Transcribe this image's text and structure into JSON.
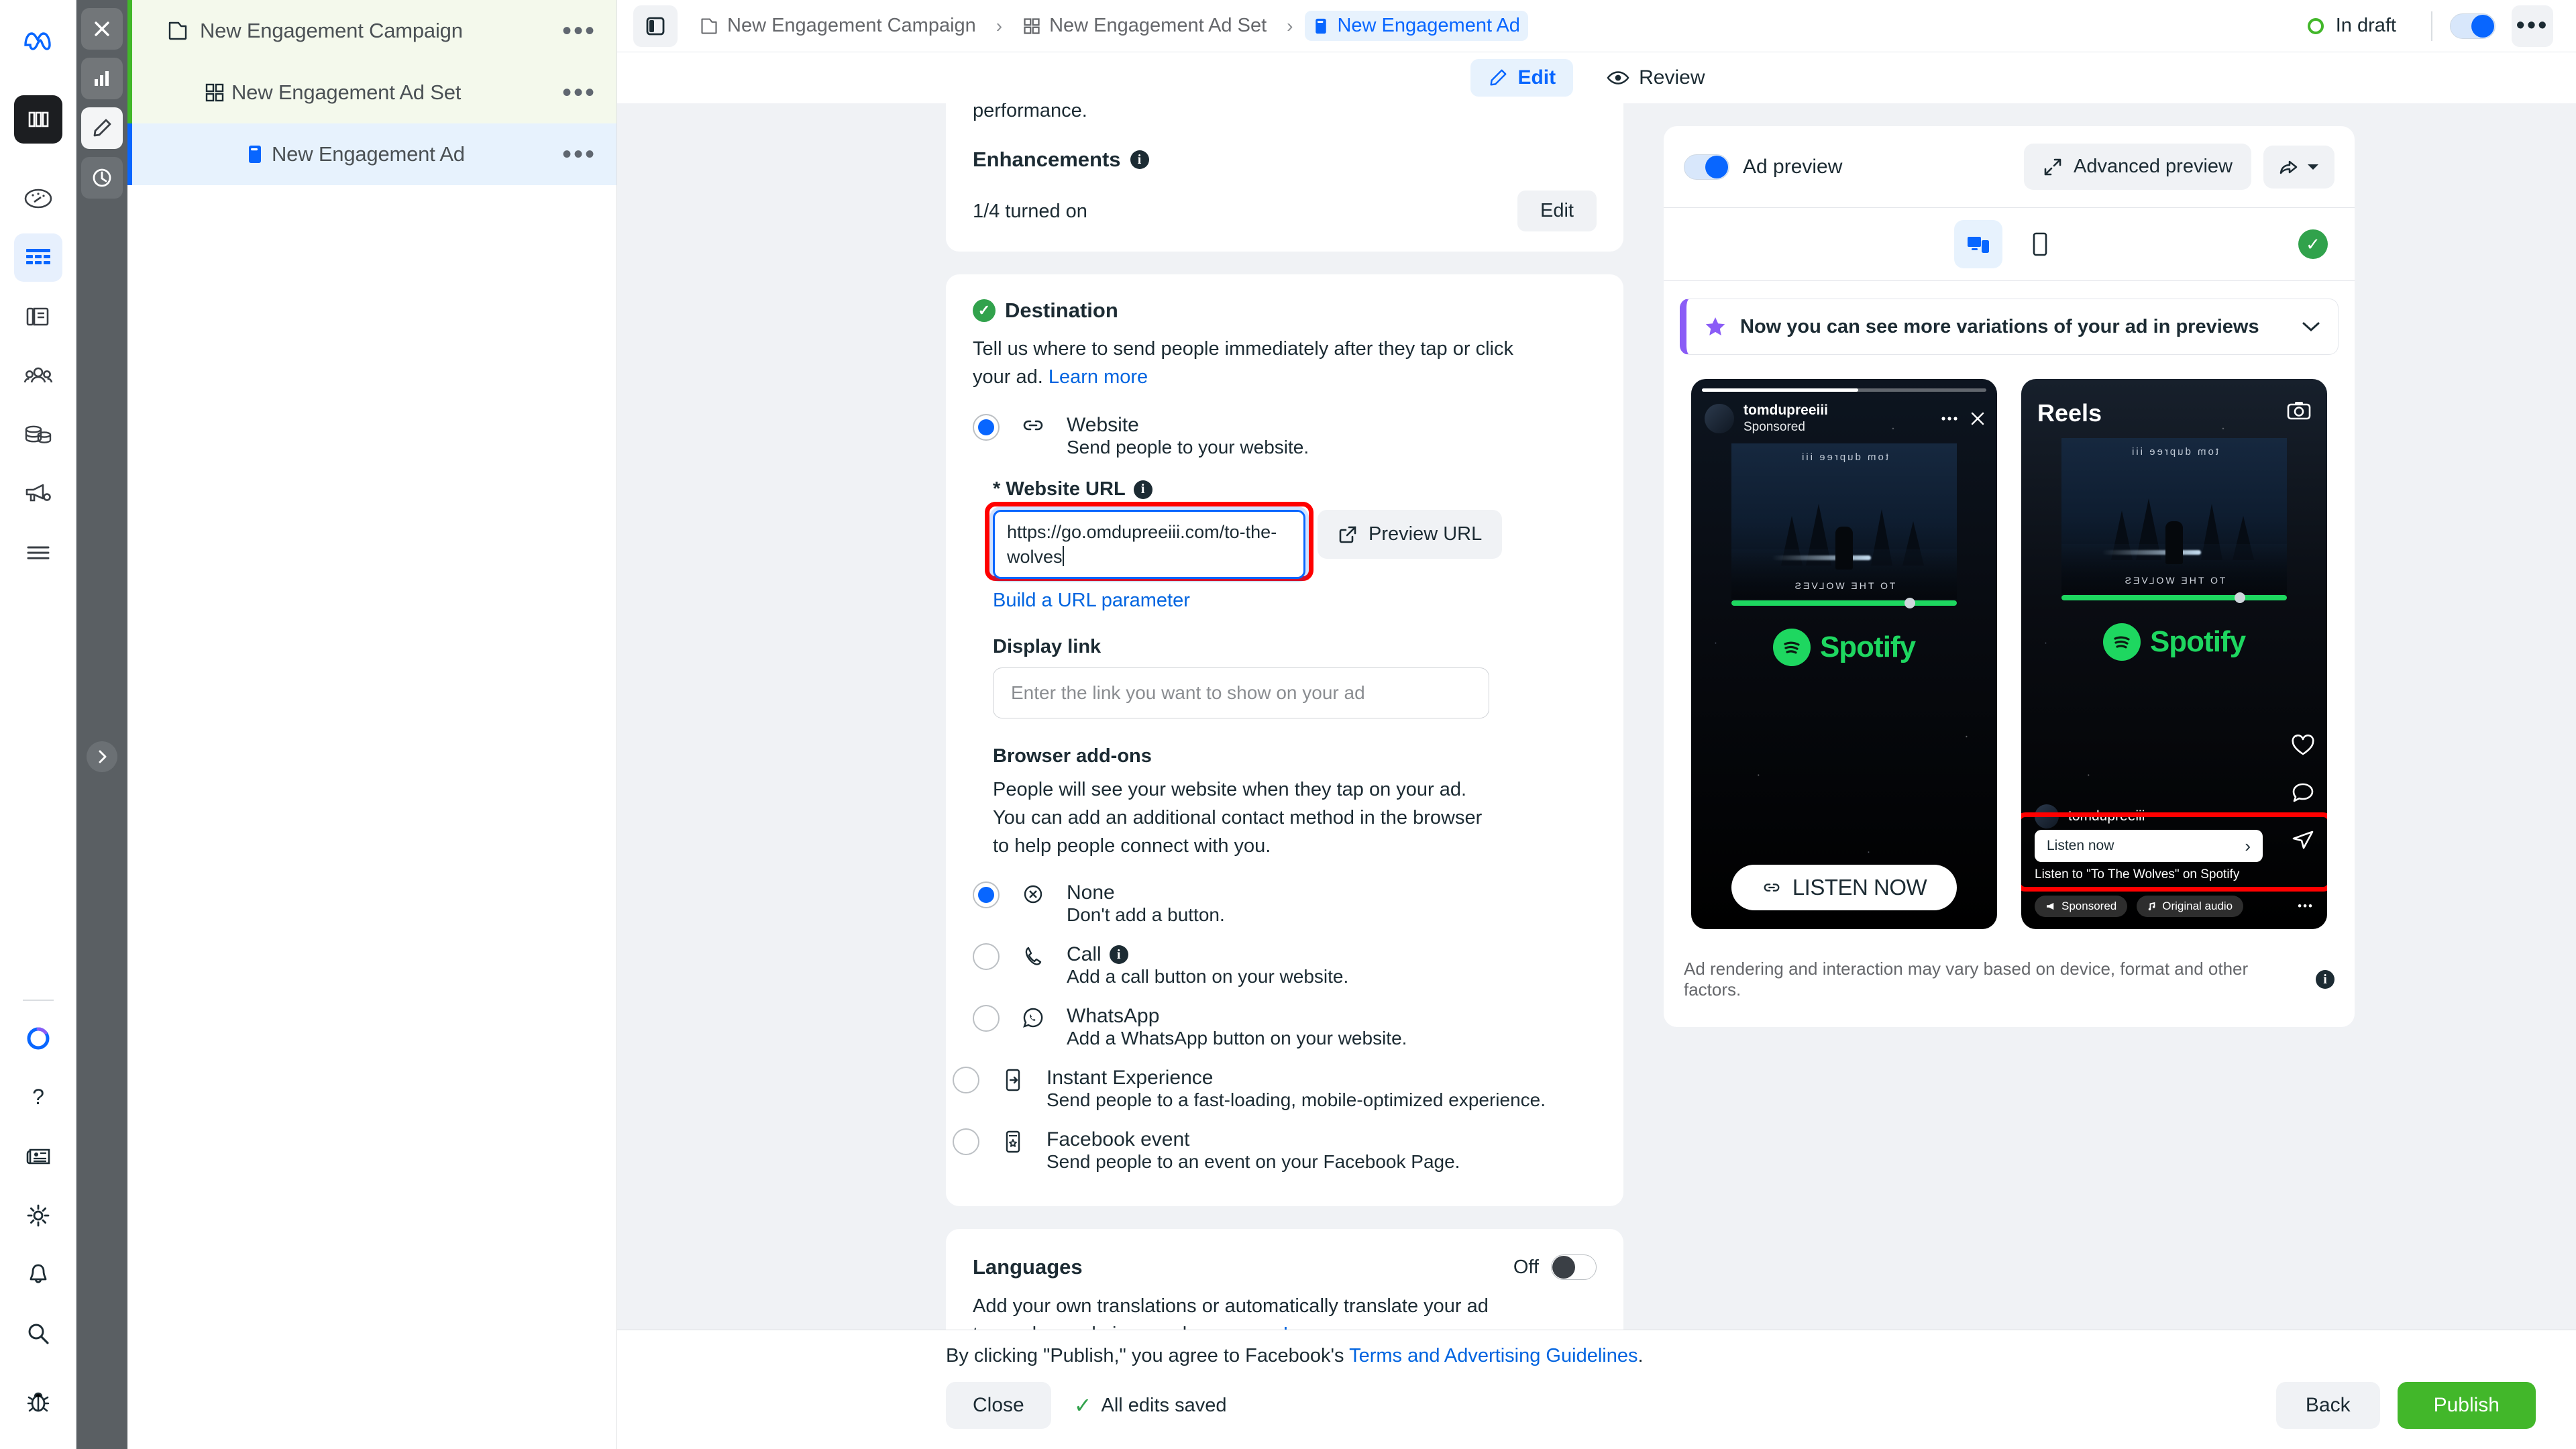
{
  "tree": {
    "items": [
      {
        "label": "New Engagement Campaign",
        "icon": "folder-icon",
        "level": 1,
        "state": "campaign"
      },
      {
        "label": "New Engagement Ad Set",
        "icon": "grid-icon",
        "level": 2,
        "state": "adset"
      },
      {
        "label": "New Engagement Ad",
        "icon": "ad-icon",
        "level": 3,
        "state": "ad"
      }
    ],
    "menu_dots": "•••"
  },
  "header": {
    "breadcrumbs": [
      {
        "label": "New Engagement Campaign",
        "icon": "folder-icon",
        "active": false
      },
      {
        "label": "New Engagement Ad Set",
        "icon": "grid-icon",
        "active": false
      },
      {
        "label": "New Engagement Ad",
        "icon": "ad-icon",
        "active": true
      }
    ],
    "separator": "›",
    "status_label": "In draft",
    "status_color": "#42b72a",
    "more_dots": "•••"
  },
  "tabs": [
    {
      "label": "Edit",
      "icon": "pencil-icon",
      "active": true
    },
    {
      "label": "Review",
      "icon": "eye-icon",
      "active": false
    }
  ],
  "enhancements": {
    "cut_text": "performance.",
    "title": "Enhancements",
    "value": "1/4 turned on",
    "edit_label": "Edit"
  },
  "destination": {
    "title": "Destination",
    "description": "Tell us where to send people immediately after they tap or click your ad.",
    "learn_more": "Learn more",
    "website_option": {
      "title": "Website",
      "subtitle": "Send people to your website.",
      "selected": true
    },
    "url_field_label": "* Website URL",
    "url_value": "https://go.omdupreeiii.com/to-the-wolves",
    "preview_url_label": "Preview URL",
    "build_param_label": "Build a URL parameter",
    "display_link_label": "Display link",
    "display_link_placeholder": "Enter the link you want to show on your ad",
    "addons_title": "Browser add-ons",
    "addons_description": "People will see your website when they tap on your ad. You can add an additional contact method in the browser to help people connect with you.",
    "addons": [
      {
        "title": "None",
        "subtitle": "Don't add a button.",
        "icon": "circle-x-icon",
        "selected": true,
        "info": false
      },
      {
        "title": "Call",
        "subtitle": "Add a call button on your website.",
        "icon": "phone-icon",
        "selected": false,
        "info": true
      },
      {
        "title": "WhatsApp",
        "subtitle": "Add a WhatsApp button on your website.",
        "icon": "whatsapp-icon",
        "selected": false,
        "info": false
      },
      {
        "title": "Instant Experience",
        "subtitle": "Send people to a fast-loading, mobile-optimized experience.",
        "icon": "instant-experience-icon",
        "selected": false,
        "info": false
      },
      {
        "title": "Facebook event",
        "subtitle": "Send people to an event on your Facebook Page.",
        "icon": "facebook-event-icon",
        "selected": false,
        "info": false
      }
    ]
  },
  "languages": {
    "title": "Languages",
    "toggle_label": "Off",
    "description": "Add your own translations or automatically translate your ad to reach people in more languages.",
    "learn_more": "Learn more"
  },
  "preview": {
    "toggle_label": "Ad preview",
    "advanced_label": "Advanced preview",
    "banner_text": "Now you can see more variations of your ad in previews",
    "disclaimer": "Ad rendering and interaction may vary based on device, format and other factors.",
    "story": {
      "account": "tomdupreeiii",
      "sponsored": "Sponsored",
      "artwork_title": "tom dupree iii",
      "artwork_subtitle": "TO THE WOLVES",
      "brand": "Spotify",
      "cta": "LISTEN NOW"
    },
    "reels": {
      "title": "Reels",
      "account": "tomdupreeiii",
      "artwork_title": "tom dupree iii",
      "artwork_subtitle": "TO THE WOLVES",
      "brand": "Spotify",
      "cta": "Listen now",
      "cta_arrow": "›",
      "subtitle": "Listen to \"To The Wolves\" on Spotify",
      "chip_sponsored": "Sponsored",
      "chip_audio": "Original audio",
      "more_dots": "•••"
    }
  },
  "footer": {
    "terms_prefix": "By clicking \"Publish,\" you agree to Facebook's ",
    "terms_link": "Terms and Advertising Guidelines",
    "terms_suffix": ".",
    "close_label": "Close",
    "saved_label": "All edits saved",
    "back_label": "Back",
    "publish_label": "Publish"
  },
  "colors": {
    "accent_blue": "#0866ff",
    "link_blue": "#0064e0",
    "green": "#42b72a",
    "spotify_green": "#1ed760",
    "highlight_red": "#ff0000",
    "purple": "#8a5cf6"
  }
}
